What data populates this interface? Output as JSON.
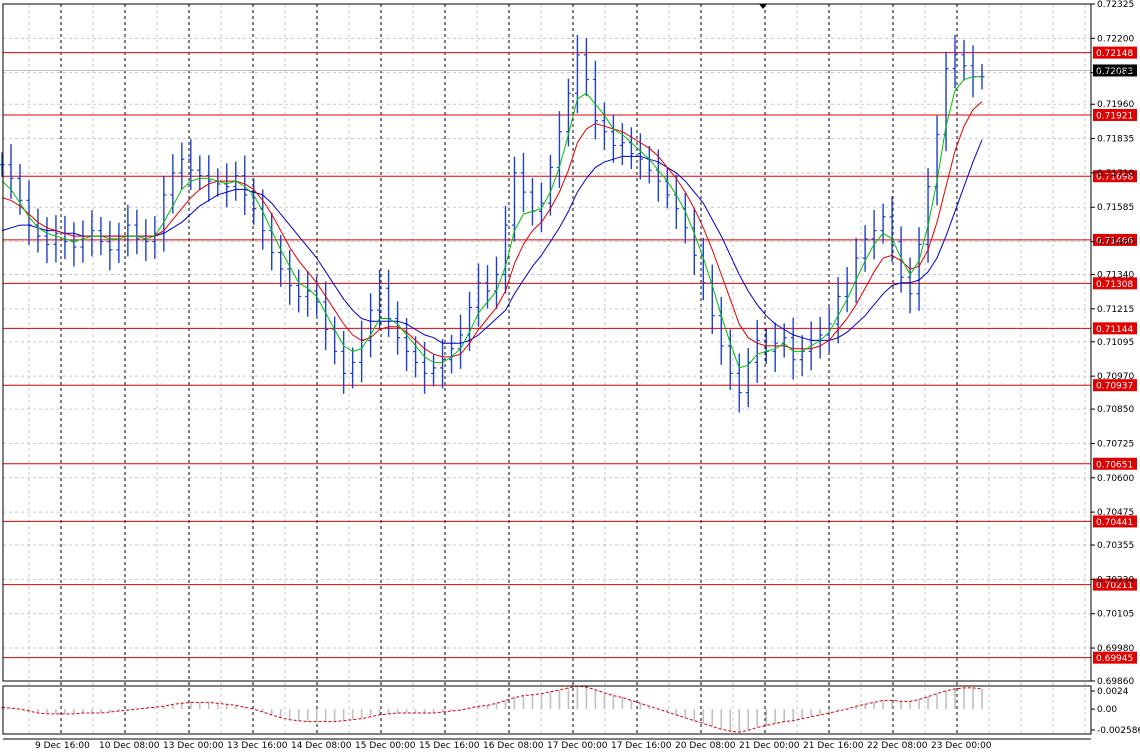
{
  "chart_data": {
    "type": "line",
    "chart_kind": "candlestick",
    "instrument_note": "",
    "price_axis": {
      "ticks": [
        "0.72325",
        "0.72200",
        "0.72075",
        "0.71960",
        "0.71835",
        "0.71710",
        "0.71585",
        "0.71460",
        "0.71340",
        "0.71215",
        "0.71095",
        "0.70970",
        "0.70850",
        "0.70725",
        "0.70600",
        "0.70475",
        "0.70355",
        "0.70230",
        "0.70105",
        "0.69980",
        "0.69860"
      ],
      "range": [
        0.6986,
        0.72325
      ]
    },
    "horizontal_levels": [
      0.72148,
      0.71921,
      0.71698,
      0.71466,
      0.71308,
      0.71144,
      0.70937,
      0.70651,
      0.70441,
      0.70211,
      0.69945
    ],
    "horizontal_level_labels": [
      "0.72148",
      "0.71921",
      "0.71698",
      "0.71466",
      "0.71308",
      "0.71144",
      "0.70937",
      "0.70651",
      "0.70441",
      "0.70211",
      "0.69945"
    ],
    "current_price": 0.72083,
    "current_price_label": "0.72083",
    "time_axis": {
      "labels": [
        "9 Dec 16:00",
        "10 Dec 08:00",
        "13 Dec 00:00",
        "13 Dec 16:00",
        "14 Dec 08:00",
        "15 Dec 00:00",
        "15 Dec 16:00",
        "16 Dec 08:00",
        "17 Dec 00:00",
        "17 Dec 16:00",
        "20 Dec 08:00",
        "21 Dec 00:00",
        "21 Dec 16:00",
        "22 Dec 08:00",
        "23 Dec 00:00"
      ]
    },
    "price_series": [
      0.7174,
      0.7169,
      0.7161,
      0.7152,
      0.7148,
      0.7145,
      0.7149,
      0.7146,
      0.7144,
      0.7148,
      0.715,
      0.7146,
      0.7143,
      0.7148,
      0.7152,
      0.7147,
      0.7146,
      0.7149,
      0.7163,
      0.7171,
      0.7176,
      0.7172,
      0.717,
      0.7168,
      0.7167,
      0.7166,
      0.717,
      0.7163,
      0.7158,
      0.715,
      0.7142,
      0.7136,
      0.713,
      0.7126,
      0.7128,
      0.7124,
      0.7114,
      0.7106,
      0.7098,
      0.7102,
      0.711,
      0.7121,
      0.7129,
      0.7118,
      0.7111,
      0.7106,
      0.7102,
      0.7098,
      0.71,
      0.7103,
      0.7107,
      0.7112,
      0.7122,
      0.7131,
      0.7128,
      0.7134,
      0.7152,
      0.7171,
      0.7164,
      0.7157,
      0.716,
      0.7173,
      0.7186,
      0.72,
      0.7214,
      0.7205,
      0.719,
      0.7186,
      0.7181,
      0.7182,
      0.7178,
      0.7176,
      0.7172,
      0.7168,
      0.7163,
      0.7158,
      0.7151,
      0.7141,
      0.7131,
      0.7119,
      0.7108,
      0.7098,
      0.7091,
      0.7102,
      0.711,
      0.7106,
      0.7109,
      0.7111,
      0.7103,
      0.7106,
      0.711,
      0.7112,
      0.7116,
      0.7126,
      0.7131,
      0.714,
      0.7147,
      0.715,
      0.7155,
      0.7146,
      0.7133,
      0.7127,
      0.7145,
      0.7166,
      0.7185,
      0.7209,
      0.7214,
      0.721,
      0.7206,
      0.7206
    ],
    "ma_fast": [
      0.7168,
      0.7165,
      0.716,
      0.7155,
      0.7151,
      0.7149,
      0.7148,
      0.7147,
      0.7146,
      0.7147,
      0.7148,
      0.7148,
      0.7147,
      0.7147,
      0.7148,
      0.7148,
      0.7147,
      0.7148,
      0.7153,
      0.7159,
      0.7165,
      0.7168,
      0.7169,
      0.7169,
      0.7168,
      0.7167,
      0.7168,
      0.7166,
      0.7163,
      0.7157,
      0.715,
      0.7143,
      0.7137,
      0.7131,
      0.7129,
      0.7126,
      0.712,
      0.7114,
      0.7108,
      0.7106,
      0.7107,
      0.7112,
      0.7118,
      0.7118,
      0.7116,
      0.7112,
      0.7108,
      0.7104,
      0.7102,
      0.7102,
      0.7104,
      0.7107,
      0.7113,
      0.712,
      0.7124,
      0.7128,
      0.7137,
      0.715,
      0.7156,
      0.7157,
      0.7158,
      0.7164,
      0.7173,
      0.7185,
      0.7198,
      0.72,
      0.7196,
      0.7192,
      0.7187,
      0.7185,
      0.7182,
      0.7179,
      0.7176,
      0.7172,
      0.7168,
      0.7163,
      0.7157,
      0.7149,
      0.714,
      0.713,
      0.7119,
      0.7109,
      0.71,
      0.7101,
      0.7105,
      0.7106,
      0.7107,
      0.7109,
      0.7106,
      0.7106,
      0.7108,
      0.711,
      0.7113,
      0.7119,
      0.7125,
      0.7132,
      0.7139,
      0.7145,
      0.7149,
      0.7147,
      0.714,
      0.7134,
      0.7139,
      0.7152,
      0.7168,
      0.7188,
      0.7201,
      0.7205,
      0.7206,
      0.7206
    ],
    "ma_mid": [
      0.7162,
      0.7161,
      0.7159,
      0.7156,
      0.7153,
      0.7151,
      0.715,
      0.7149,
      0.7148,
      0.7148,
      0.7148,
      0.7148,
      0.7148,
      0.7148,
      0.7148,
      0.7148,
      0.7148,
      0.7148,
      0.715,
      0.7154,
      0.7158,
      0.7162,
      0.7165,
      0.7167,
      0.7168,
      0.7168,
      0.7168,
      0.7167,
      0.7165,
      0.7161,
      0.7156,
      0.715,
      0.7144,
      0.7139,
      0.7135,
      0.7131,
      0.7126,
      0.7121,
      0.7116,
      0.7112,
      0.711,
      0.7111,
      0.7114,
      0.7115,
      0.7115,
      0.7113,
      0.711,
      0.7107,
      0.7105,
      0.7104,
      0.7104,
      0.7105,
      0.7109,
      0.7114,
      0.7118,
      0.7122,
      0.7128,
      0.7138,
      0.7145,
      0.715,
      0.7153,
      0.7158,
      0.7164,
      0.7172,
      0.7182,
      0.7187,
      0.7189,
      0.7188,
      0.7187,
      0.7186,
      0.7184,
      0.7182,
      0.718,
      0.7177,
      0.7173,
      0.7169,
      0.7164,
      0.7158,
      0.7151,
      0.7143,
      0.7134,
      0.7125,
      0.7116,
      0.7111,
      0.7109,
      0.7108,
      0.7108,
      0.7108,
      0.7107,
      0.7107,
      0.7107,
      0.7108,
      0.711,
      0.7114,
      0.7118,
      0.7123,
      0.7129,
      0.7135,
      0.714,
      0.7141,
      0.7139,
      0.7136,
      0.7137,
      0.7143,
      0.7153,
      0.7166,
      0.7179,
      0.7188,
      0.7194,
      0.7197
    ],
    "ma_slow": [
      0.715,
      0.7151,
      0.7152,
      0.7152,
      0.7151,
      0.715,
      0.715,
      0.7149,
      0.7149,
      0.7148,
      0.7148,
      0.7148,
      0.7148,
      0.7148,
      0.7148,
      0.7148,
      0.7148,
      0.7148,
      0.7149,
      0.7151,
      0.7153,
      0.7156,
      0.7159,
      0.7161,
      0.7163,
      0.7164,
      0.7165,
      0.7165,
      0.7164,
      0.7163,
      0.716,
      0.7156,
      0.7152,
      0.7148,
      0.7144,
      0.714,
      0.7135,
      0.713,
      0.7125,
      0.7121,
      0.7118,
      0.7117,
      0.7117,
      0.7117,
      0.7117,
      0.7116,
      0.7114,
      0.7112,
      0.7111,
      0.7109,
      0.7109,
      0.7109,
      0.711,
      0.7112,
      0.7115,
      0.7118,
      0.7121,
      0.7127,
      0.7132,
      0.7137,
      0.7141,
      0.7146,
      0.7151,
      0.7157,
      0.7164,
      0.7169,
      0.7173,
      0.7175,
      0.7176,
      0.7177,
      0.7177,
      0.7177,
      0.7176,
      0.7175,
      0.7173,
      0.7171,
      0.7168,
      0.7164,
      0.716,
      0.7154,
      0.7148,
      0.7141,
      0.7134,
      0.7128,
      0.7123,
      0.7119,
      0.7116,
      0.7114,
      0.7112,
      0.7111,
      0.711,
      0.711,
      0.711,
      0.7111,
      0.7113,
      0.7116,
      0.7119,
      0.7123,
      0.7127,
      0.713,
      0.7131,
      0.7131,
      0.7132,
      0.7135,
      0.714,
      0.7148,
      0.7157,
      0.7166,
      0.7175,
      0.7183
    ],
    "oscillator": {
      "ticks": [
        "0.0024",
        "0.00",
        "-0.002586"
      ],
      "range": [
        -0.002586,
        0.0024
      ],
      "values": [
        0.0002,
        0.0001,
        0.0,
        -0.0002,
        -0.0004,
        -0.0005,
        -0.0005,
        -0.0005,
        -0.0005,
        -0.0004,
        -0.0004,
        -0.0004,
        -0.0003,
        -0.0002,
        -0.0001,
        0.0,
        0.0001,
        0.0002,
        0.0003,
        0.0005,
        0.0006,
        0.0007,
        0.0007,
        0.0007,
        0.0006,
        0.0005,
        0.0004,
        0.0002,
        0.0,
        -0.0003,
        -0.0006,
        -0.0009,
        -0.0011,
        -0.0012,
        -0.0013,
        -0.0013,
        -0.0013,
        -0.0013,
        -0.0012,
        -0.0011,
        -0.001,
        -0.0008,
        -0.0006,
        -0.0005,
        -0.0004,
        -0.0004,
        -0.0004,
        -0.0004,
        -0.0004,
        -0.0003,
        -0.0002,
        -0.0001,
        0.0001,
        0.0003,
        0.0004,
        0.0006,
        0.0009,
        0.0012,
        0.0014,
        0.0015,
        0.0016,
        0.0018,
        0.002,
        0.0022,
        0.0024,
        0.0023,
        0.002,
        0.0017,
        0.0014,
        0.0012,
        0.0009,
        0.0006,
        0.0003,
        0.0,
        -0.0003,
        -0.0006,
        -0.0009,
        -0.0012,
        -0.0015,
        -0.0018,
        -0.0021,
        -0.0023,
        -0.0024,
        -0.0022,
        -0.0019,
        -0.0017,
        -0.0015,
        -0.0013,
        -0.0012,
        -0.001,
        -0.0008,
        -0.0006,
        -0.0004,
        -0.0002,
        0.0,
        0.0003,
        0.0005,
        0.0007,
        0.0009,
        0.0009,
        0.0008,
        0.0008,
        0.001,
        0.0013,
        0.0016,
        0.0019,
        0.0021,
        0.0022,
        0.0022,
        0.0021
      ]
    },
    "colors": {
      "price": "#1c3fcf",
      "ma_fast": "#00c000",
      "ma_mid": "#e00000",
      "ma_slow": "#0000c8",
      "level": "#e00000",
      "oscillator": "#e00000",
      "histogram": "#c0c0c0"
    },
    "grid": true
  }
}
